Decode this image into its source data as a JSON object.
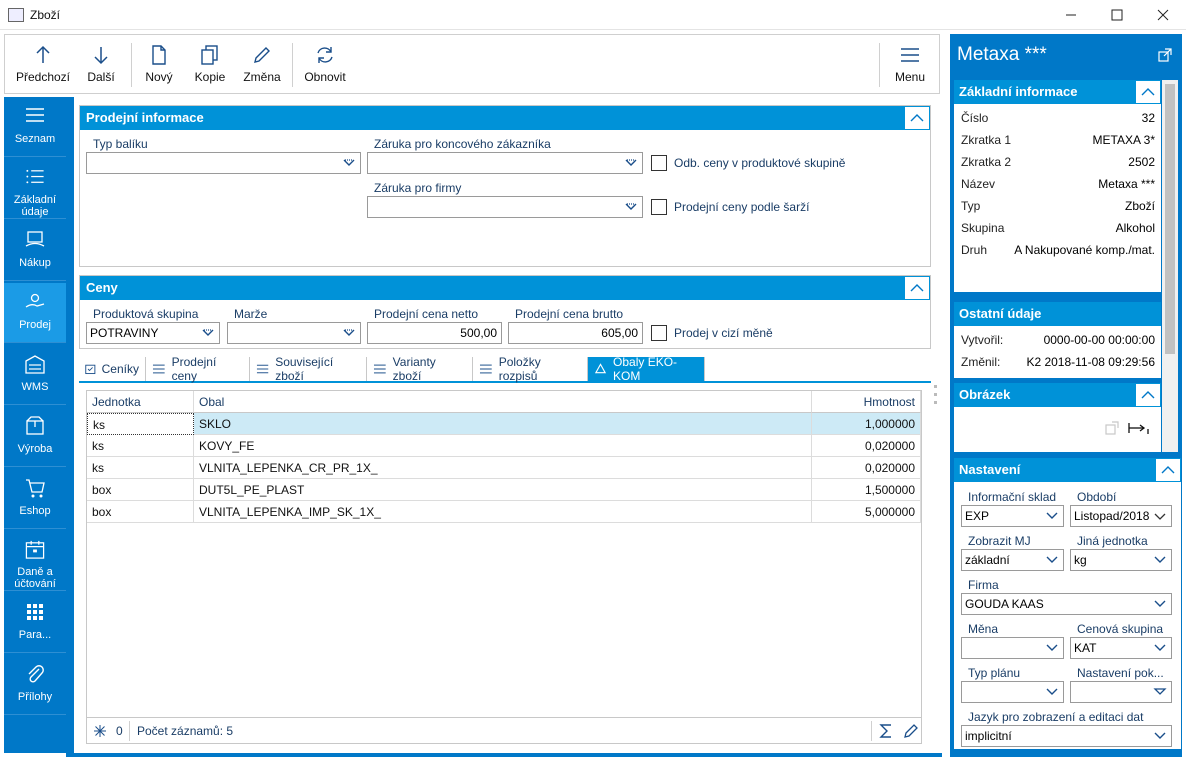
{
  "window": {
    "title": "Zboží"
  },
  "toolbar": {
    "prev": "Předchozí",
    "next": "Další",
    "new": "Nový",
    "copy": "Kopie",
    "change": "Změna",
    "refresh": "Obnovit",
    "menu": "Menu"
  },
  "nav": {
    "items": [
      {
        "label": "Seznam",
        "icon": "list-icon"
      },
      {
        "label": "Základní údaje",
        "icon": "bullet-list-icon"
      },
      {
        "label": "Nákup",
        "icon": "purchase-icon"
      },
      {
        "label": "Prodej",
        "icon": "sales-icon"
      },
      {
        "label": "WMS",
        "icon": "warehouse-icon"
      },
      {
        "label": "Výroba",
        "icon": "production-icon"
      },
      {
        "label": "Eshop",
        "icon": "cart-icon"
      },
      {
        "label": "Daně a účtování",
        "icon": "calendar-icon"
      },
      {
        "label": "Para...",
        "icon": "grid-icon"
      },
      {
        "label": "Přílohy",
        "icon": "paperclip-icon"
      }
    ]
  },
  "sales_info": {
    "title": "Prodejní informace",
    "package_type_label": "Typ balíku",
    "package_type_value": "",
    "warranty_customer_label": "Záruka pro koncového zákazníka",
    "warranty_customer_value": "",
    "warranty_company_label": "Záruka pro firmy",
    "warranty_company_value": "",
    "diff_prices_label": "Odb. ceny v produktové skupině",
    "batch_prices_label": "Prodejní ceny podle šarží"
  },
  "prices": {
    "title": "Ceny",
    "product_group_label": "Produktová skupina",
    "product_group_value": "POTRAVINY",
    "margin_label": "Marže",
    "margin_value": "",
    "net_label": "Prodejní cena netto",
    "net_value": "500,00",
    "gross_label": "Prodejní cena brutto",
    "gross_value": "605,00",
    "foreign_label": "Prodej v cizí měně"
  },
  "tabs": [
    "Ceníky",
    "Prodejní ceny",
    "Související zboží",
    "Varianty zboží",
    "Položky rozpisů",
    "Obaly EKO-KOM"
  ],
  "grid": {
    "columns": [
      "Jednotka",
      "Obal",
      "Hmotnost"
    ],
    "rows": [
      [
        "ks",
        "SKLO",
        "1,000000"
      ],
      [
        "ks",
        "KOVY_FE",
        "0,020000"
      ],
      [
        "ks",
        "VLNITA_LEPENKA_CR_PR_1X_",
        "0,020000"
      ],
      [
        "box",
        "DUT5L_PE_PLAST",
        "1,500000"
      ],
      [
        "box",
        "VLNITA_LEPENKA_IMP_SK_1X_",
        "5,000000"
      ]
    ],
    "footer_count": "0",
    "footer_records": "Počet záznamů: 5"
  },
  "right": {
    "title": "Metaxa ***",
    "basic": {
      "title": "Základní informace",
      "rows": [
        {
          "label": "Číslo",
          "value": "32"
        },
        {
          "label": "Zkratka 1",
          "value": "METAXA 3*"
        },
        {
          "label": "Zkratka 2",
          "value": "2502"
        },
        {
          "label": "Název",
          "value": "Metaxa ***"
        },
        {
          "label": "Typ",
          "value": "Zboží"
        },
        {
          "label": "Skupina",
          "value": "Alkohol"
        },
        {
          "label": "Druh",
          "value": "A Nakupované komp./mat."
        }
      ]
    },
    "other": {
      "title": "Ostatní údaje",
      "rows": [
        {
          "label": "Vytvořil:",
          "value": "0000-00-00 00:00:00"
        },
        {
          "label": "Změnil:",
          "value": "K2 2018-11-08 09:29:56"
        }
      ]
    },
    "image": {
      "title": "Obrázek"
    },
    "settings": {
      "title": "Nastavení",
      "info_store_label": "Informační sklad",
      "info_store_value": "EXP",
      "period_label": "Období",
      "period_value": "Listopad/2018",
      "unit_label": "Zobrazit MJ",
      "unit_value": "základní",
      "other_unit_label": "Jiná jednotka",
      "other_unit_value": "kg",
      "company_label": "Firma",
      "company_value": "GOUDA KAAS",
      "currency_label": "Měna",
      "currency_value": "",
      "price_group_label": "Cenová skupina",
      "price_group_value": "KAT",
      "plan_type_label": "Typ plánu",
      "plan_type_value": "",
      "setting_label": "Nastavení pok...",
      "setting_value": "",
      "language_label": "Jazyk pro zobrazení a editaci dat",
      "language_value": "implicitní"
    }
  },
  "colors": {
    "accent": "#0092d8",
    "nav": "#0078c8",
    "selection": "#cdeaf6"
  }
}
